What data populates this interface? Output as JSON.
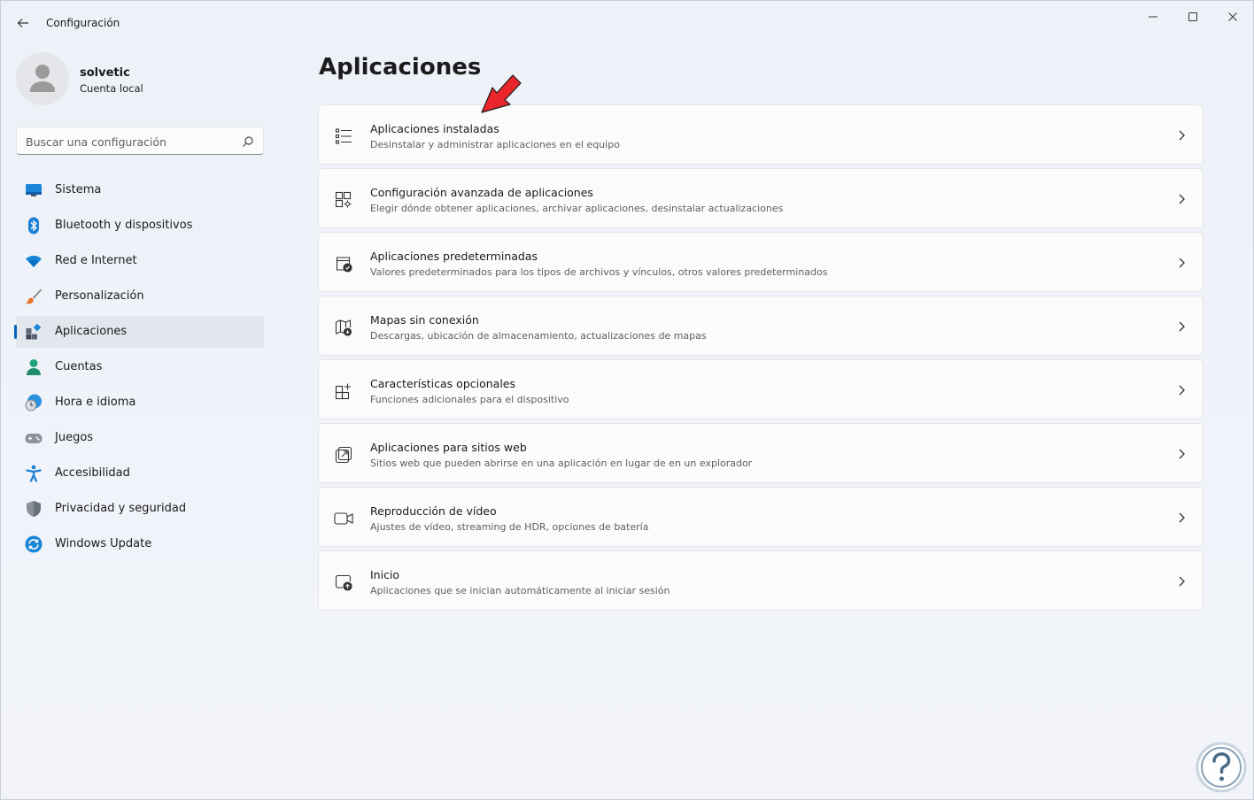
{
  "window": {
    "title": "Configuración"
  },
  "profile": {
    "name": "solvetic",
    "account_type": "Cuenta local"
  },
  "search": {
    "placeholder": "Buscar una configuración"
  },
  "nav": {
    "items": [
      {
        "label": "Sistema",
        "icon": "monitor-icon"
      },
      {
        "label": "Bluetooth y dispositivos",
        "icon": "bluetooth-icon"
      },
      {
        "label": "Red e Internet",
        "icon": "wifi-icon"
      },
      {
        "label": "Personalización",
        "icon": "brush-icon"
      },
      {
        "label": "Aplicaciones",
        "icon": "apps-icon",
        "selected": true
      },
      {
        "label": "Cuentas",
        "icon": "person-icon"
      },
      {
        "label": "Hora e idioma",
        "icon": "clock-globe-icon"
      },
      {
        "label": "Juegos",
        "icon": "gamepad-icon"
      },
      {
        "label": "Accesibilidad",
        "icon": "accessibility-icon"
      },
      {
        "label": "Privacidad y seguridad",
        "icon": "shield-icon"
      },
      {
        "label": "Windows Update",
        "icon": "update-icon"
      }
    ]
  },
  "main": {
    "title": "Aplicaciones",
    "cards": [
      {
        "title": "Aplicaciones instaladas",
        "desc": "Desinstalar y administrar aplicaciones en el equipo",
        "icon": "list-icon"
      },
      {
        "title": "Configuración avanzada de aplicaciones",
        "desc": "Elegir dónde obtener aplicaciones, archivar aplicaciones, desinstalar actualizaciones",
        "icon": "apps-gear-icon"
      },
      {
        "title": "Aplicaciones predeterminadas",
        "desc": "Valores predeterminados para los tipos de archivos y vínculos, otros valores predeterminados",
        "icon": "default-apps-icon"
      },
      {
        "title": "Mapas sin conexión",
        "desc": "Descargas, ubicación de almacenamiento, actualizaciones de mapas",
        "icon": "map-download-icon"
      },
      {
        "title": "Características opcionales",
        "desc": "Funciones adicionales para el dispositivo",
        "icon": "add-features-icon"
      },
      {
        "title": "Aplicaciones para sitios web",
        "desc": "Sitios web que pueden abrirse en una aplicación en lugar de en un explorador",
        "icon": "open-in-app-icon"
      },
      {
        "title": "Reproducción de vídeo",
        "desc": "Ajustes de vídeo, streaming de HDR, opciones de batería",
        "icon": "video-icon"
      },
      {
        "title": "Inicio",
        "desc": "Aplicaciones que se inician automáticamente al iniciar sesión",
        "icon": "startup-icon"
      }
    ]
  },
  "colors": {
    "accent": "#0067c0",
    "annotation_arrow": "#e8262b"
  }
}
